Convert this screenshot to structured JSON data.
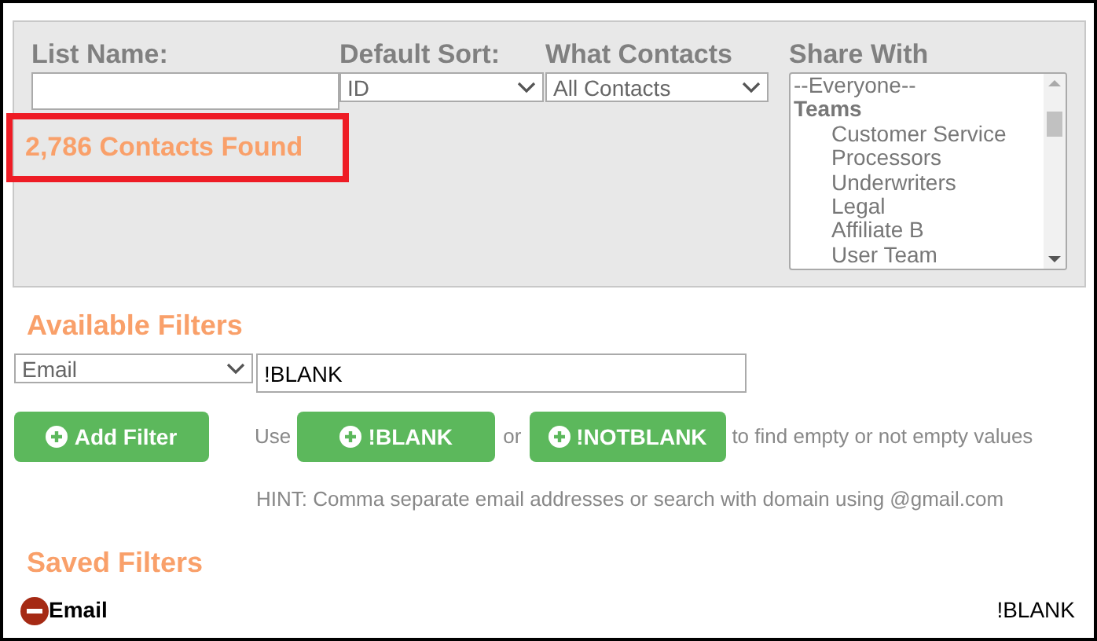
{
  "list_name": {
    "label": "List Name:"
  },
  "default_sort": {
    "label": "Default Sort:",
    "value": "ID"
  },
  "what_contacts": {
    "label": "What Contacts",
    "value": "All Contacts"
  },
  "share_with": {
    "label": "Share With",
    "options": [
      {
        "kind": "option",
        "label": "--Everyone--",
        "selected": false
      },
      {
        "kind": "group",
        "label": "Teams",
        "selected": false
      },
      {
        "kind": "sub",
        "label": "Customer Service",
        "selected": false
      },
      {
        "kind": "sub",
        "label": "Processors",
        "selected": false
      },
      {
        "kind": "sub",
        "label": "Underwriters",
        "selected": false
      },
      {
        "kind": "sub",
        "label": "Legal",
        "selected": false
      },
      {
        "kind": "sub",
        "label": "Affiliate B",
        "selected": false
      },
      {
        "kind": "sub",
        "label": "User Team",
        "selected": false
      }
    ]
  },
  "contacts_found": {
    "text": "2,786 Contacts Found",
    "highlighted": true
  },
  "available_filters": {
    "title": "Available Filters",
    "field": "Email",
    "value": "!BLANK",
    "add_button": "Add Filter",
    "use_text": "Use",
    "blank_button": "!BLANK",
    "or_text": "or",
    "notblank_button": "!NOTBLANK",
    "tail_text": "to find empty or not empty values",
    "hint": "HINT: Comma separate email addresses or search with domain using @gmail.com"
  },
  "saved_filters": {
    "title": "Saved Filters",
    "items": [
      {
        "field": "Email",
        "value": "!BLANK"
      }
    ]
  }
}
